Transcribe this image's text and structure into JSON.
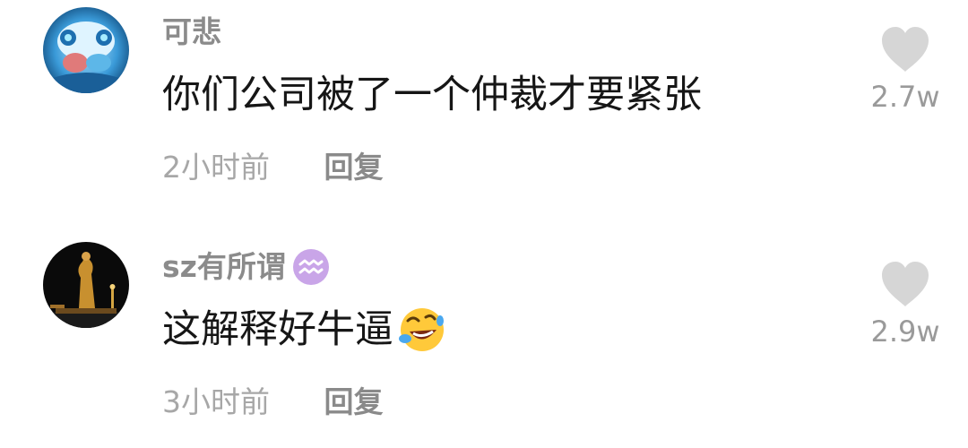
{
  "comments": [
    {
      "username": "可悲",
      "text": "你们公司被了一个仲裁才要紧张",
      "time": "2小时前",
      "reply_label": "回复",
      "like_count": "2.7w",
      "avatar_icon": "robot-creature-avatar",
      "avatar_colors": [
        "#2a87c9",
        "#9fdcff"
      ]
    },
    {
      "username": "sz有所谓",
      "badge_icon": "aquarius-zodiac-icon",
      "badge_color": "#c9a5e8",
      "text": "这解释好牛逼",
      "emoji_icon": "rolling-laughing-emoji",
      "time": "3小时前",
      "reply_label": "回复",
      "like_count": "2.9w",
      "avatar_icon": "statue-night-avatar",
      "avatar_colors": [
        "#0a0a0a",
        "#c8902f"
      ]
    }
  ],
  "colors": {
    "username": "#8b8b8b",
    "text": "#161616",
    "meta": "#a7a7a7",
    "heart": "#d6d6d6"
  }
}
